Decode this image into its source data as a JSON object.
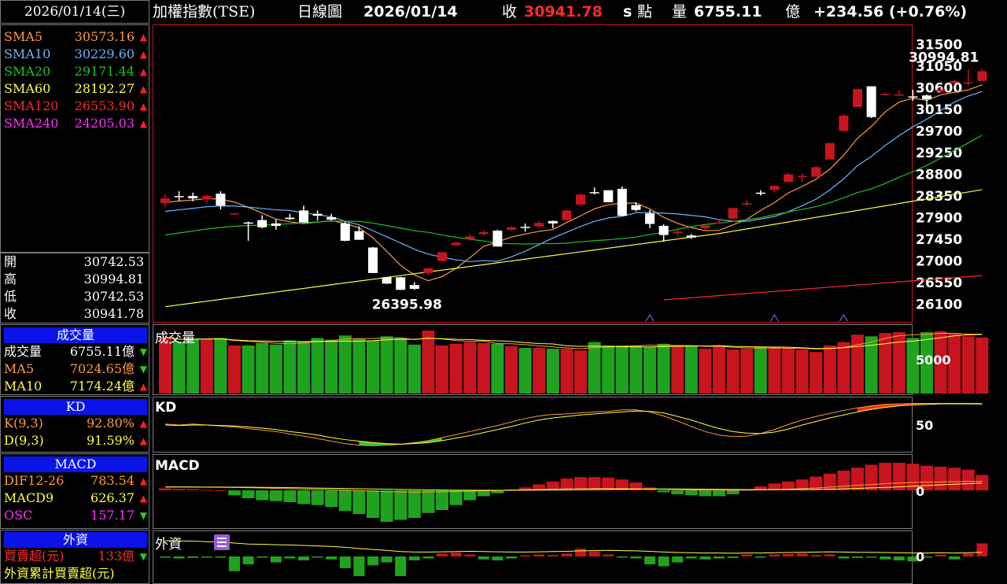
{
  "header": {
    "date": "2026/01/14(三)",
    "index_name": "加權指數(TSE)",
    "chart_kind": "日線圖",
    "quote_date": "2026/01/14",
    "close_label": "收",
    "close_value": "30941.78",
    "s_label": "s",
    "point_label": "點",
    "volume_label": "量",
    "volume_value": "6755.11",
    "volume_unit": "億",
    "change": "+234.56 (+0.76%)"
  },
  "sma": [
    {
      "label": "SMA5",
      "value": "30573.16",
      "color": "#ff9a3c",
      "dir": "up"
    },
    {
      "label": "SMA10",
      "value": "30229.60",
      "color": "#6ab6ff",
      "dir": "up"
    },
    {
      "label": "SMA20",
      "value": "29171.44",
      "color": "#22c022",
      "dir": "up"
    },
    {
      "label": "SMA60",
      "value": "28192.27",
      "color": "#ffff40",
      "dir": "up"
    },
    {
      "label": "SMA120",
      "value": "26553.90",
      "color": "#ff2a2a",
      "dir": "up"
    },
    {
      "label": "SMA240",
      "value": "24205.03",
      "color": "#ff30ff",
      "dir": "up"
    }
  ],
  "ohlc": [
    {
      "label": "開",
      "value": "30742.53"
    },
    {
      "label": "高",
      "value": "30994.81"
    },
    {
      "label": "低",
      "value": "30742.53"
    },
    {
      "label": "收",
      "value": "30941.78"
    }
  ],
  "volume_panel": {
    "header": "成交量",
    "rows": [
      {
        "label": "成交量",
        "value": "6755.11億",
        "color": "#ffffff",
        "dir": "down"
      },
      {
        "label": "MA5",
        "value": "7024.65億",
        "color": "#ff9a3c",
        "dir": "down"
      },
      {
        "label": "MA10",
        "value": "7174.24億",
        "color": "#ffff40",
        "dir": "up"
      }
    ],
    "chart_title": "成交量",
    "axis_label": "5000"
  },
  "kd_panel": {
    "header": "KD",
    "rows": [
      {
        "label": "K(9,3)",
        "value": "92.80%",
        "color": "#ff9a3c",
        "dir": "up"
      },
      {
        "label": "D(9,3)",
        "value": "91.59%",
        "color": "#ffff40",
        "dir": "up"
      }
    ],
    "chart_title": "KD",
    "axis_label": "50"
  },
  "macd_panel": {
    "header": "MACD",
    "rows": [
      {
        "label": "DIF12-26",
        "value": "783.54",
        "color": "#ff9a3c",
        "dir": "up"
      },
      {
        "label": "MACD9",
        "value": "626.37",
        "color": "#ffff40",
        "dir": "up"
      },
      {
        "label": "OSC",
        "value": "157.17",
        "color": "#ff30ff",
        "dir": "down"
      }
    ],
    "chart_title": "MACD",
    "axis_label": "0"
  },
  "foreign_panel": {
    "header": "外資",
    "rows": [
      {
        "label": "買賣超(元)",
        "value": "133億",
        "color": "#ff2a2a",
        "dir": "down"
      },
      {
        "label": "外資累計買賣超(元)",
        "value": "",
        "color": "#ffff40",
        "dir": ""
      }
    ],
    "chart_title": "外資",
    "axis_label": "0"
  },
  "colors": {
    "up": "#c8141e",
    "down": "#ffffff",
    "vol_up": "#c8141e",
    "vol_down": "#1fa31f",
    "arrow_up": "#ff2020",
    "arrow_down": "#22cc22",
    "axis": "#ffffff"
  },
  "chart_data": {
    "type": "candlestick",
    "price_axis": {
      "ticks": [
        31500,
        31050,
        30600,
        30150,
        29700,
        29250,
        28800,
        28350,
        27900,
        27450,
        27000,
        26550,
        26100
      ],
      "ylim": [
        25750,
        31900
      ]
    },
    "annotations": [
      {
        "text": "30994.81",
        "kind": "high"
      },
      {
        "text": "26395.98",
        "kind": "low"
      }
    ],
    "candles": [
      [
        28200,
        28380,
        28120,
        28300
      ],
      [
        28350,
        28450,
        28250,
        28330
      ],
      [
        28350,
        28420,
        28240,
        28300
      ],
      [
        28280,
        28380,
        28200,
        28350
      ],
      [
        28400,
        28450,
        28070,
        28150
      ],
      [
        27990,
        28000,
        27960,
        27990
      ],
      [
        27800,
        27820,
        27420,
        27780
      ],
      [
        27850,
        27950,
        27680,
        27700
      ],
      [
        27780,
        27860,
        27650,
        27730
      ],
      [
        27900,
        27980,
        27850,
        27870
      ],
      [
        28050,
        28150,
        27800,
        27800
      ],
      [
        27980,
        28050,
        27840,
        27940
      ],
      [
        27910,
        27980,
        27840,
        27860
      ],
      [
        27780,
        27820,
        27410,
        27420
      ],
      [
        27620,
        27720,
        27440,
        27440
      ],
      [
        27280,
        27290,
        26750,
        26750
      ],
      [
        26660,
        26670,
        26520,
        26530
      ],
      [
        26660,
        26670,
        26400,
        26400
      ],
      [
        26500,
        26560,
        26400,
        26420
      ],
      [
        26750,
        26850,
        26700,
        26850
      ],
      [
        27000,
        27180,
        27000,
        27180
      ],
      [
        27330,
        27410,
        27290,
        27380
      ],
      [
        27460,
        27560,
        27420,
        27510
      ],
      [
        27560,
        27630,
        27530,
        27600
      ],
      [
        27630,
        27650,
        27300,
        27300
      ],
      [
        27650,
        27720,
        27620,
        27700
      ],
      [
        27710,
        27780,
        27610,
        27690
      ],
      [
        27720,
        27830,
        27680,
        27790
      ],
      [
        27830,
        27840,
        27680,
        27780
      ],
      [
        27850,
        28060,
        27850,
        28050
      ],
      [
        28170,
        28410,
        28170,
        28380
      ],
      [
        28430,
        28530,
        28380,
        28420
      ],
      [
        28470,
        28470,
        28220,
        28220
      ],
      [
        28500,
        28550,
        27930,
        27940
      ],
      [
        28160,
        28220,
        28030,
        28060
      ],
      [
        27990,
        28060,
        27680,
        27770
      ],
      [
        27730,
        27760,
        27400,
        27540
      ],
      [
        27580,
        27650,
        27530,
        27610
      ],
      [
        27530,
        27560,
        27460,
        27490
      ],
      [
        27680,
        27760,
        27640,
        27740
      ],
      [
        27800,
        27850,
        27770,
        27800
      ],
      [
        27880,
        28110,
        27880,
        28100
      ],
      [
        28180,
        28260,
        28140,
        28200
      ],
      [
        28420,
        28470,
        28360,
        28410
      ],
      [
        28480,
        28570,
        28420,
        28560
      ],
      [
        28640,
        28830,
        28640,
        28800
      ],
      [
        28750,
        28830,
        28640,
        28770
      ],
      [
        28750,
        28970,
        28750,
        28950
      ],
      [
        29110,
        29450,
        29110,
        29450
      ],
      [
        29700,
        30050,
        29700,
        30020
      ],
      [
        30200,
        30570,
        30200,
        30570
      ],
      [
        30630,
        30630,
        29970,
        29990
      ],
      [
        30460,
        30500,
        30440,
        30470
      ],
      [
        30460,
        30550,
        30440,
        30460
      ],
      [
        30420,
        30560,
        30330,
        30410
      ],
      [
        30440,
        30460,
        30070,
        30360
      ],
      [
        30520,
        30620,
        30500,
        30560
      ],
      [
        30700,
        30760,
        30650,
        30740
      ],
      [
        30700,
        30980,
        30640,
        30710
      ],
      [
        30742.53,
        30994.81,
        30742.53,
        30941.78
      ]
    ],
    "volume": [
      6800,
      6300,
      6600,
      6600,
      6700,
      5800,
      5800,
      6100,
      5900,
      6400,
      6300,
      6700,
      6500,
      7000,
      6600,
      6400,
      6900,
      6700,
      5900,
      7600,
      5800,
      6000,
      6200,
      6100,
      6000,
      5700,
      5500,
      5500,
      5400,
      5400,
      5200,
      6200,
      5800,
      5800,
      5800,
      5600,
      6000,
      5800,
      5700,
      5400,
      5700,
      5300,
      5400,
      5600,
      5500,
      5500,
      5300,
      5000,
      5800,
      6200,
      7100,
      6900,
      7300,
      7400,
      6700,
      7400,
      7500,
      7300,
      6900,
      6755.11
    ],
    "kd": {
      "k": [
        52,
        50,
        52,
        50,
        48,
        46,
        43,
        40,
        37,
        32,
        28,
        23,
        18,
        13,
        10,
        9,
        10,
        12,
        15,
        19,
        25,
        31,
        37,
        43,
        49,
        56,
        63,
        68,
        71,
        72,
        74,
        76,
        77,
        80,
        80,
        76,
        68,
        58,
        47,
        37,
        30,
        27,
        28,
        33,
        41,
        51,
        60,
        67,
        73,
        79,
        84,
        88,
        91,
        92,
        93,
        93,
        93,
        93,
        93,
        92.8
      ],
      "d": [
        50,
        49,
        50,
        50,
        49,
        48,
        46,
        44,
        41,
        37,
        34,
        30,
        25,
        21,
        18,
        15,
        13,
        12,
        13,
        15,
        19,
        24,
        29,
        35,
        41,
        47,
        54,
        60,
        64,
        67,
        70,
        72,
        74,
        76,
        78,
        77,
        74,
        67,
        60,
        51,
        43,
        37,
        34,
        33,
        36,
        42,
        50,
        57,
        64,
        70,
        76,
        81,
        85,
        88,
        90,
        91,
        92,
        92,
        92,
        91.59
      ]
    },
    "macd": {
      "osc": [
        20,
        15,
        12,
        5,
        0,
        -50,
        -80,
        -100,
        -110,
        -120,
        -140,
        -150,
        -170,
        -210,
        -240,
        -280,
        -320,
        -300,
        -280,
        -230,
        -200,
        -150,
        -100,
        -60,
        -30,
        10,
        30,
        60,
        90,
        120,
        135,
        135,
        130,
        110,
        80,
        30,
        -20,
        -40,
        -50,
        -60,
        -60,
        -40,
        10,
        40,
        70,
        90,
        110,
        140,
        170,
        200,
        230,
        260,
        280,
        280,
        270,
        250,
        240,
        230,
        210,
        157
      ],
      "dif": [
        300,
        290,
        280,
        270,
        260,
        250,
        230,
        200,
        170,
        140,
        110,
        90,
        60,
        20,
        -20,
        -60,
        -120,
        -140,
        -150,
        -150,
        -130,
        -100,
        -70,
        -40,
        -10,
        20,
        50,
        80,
        110,
        140,
        160,
        170,
        160,
        150,
        140,
        120,
        90,
        60,
        40,
        20,
        10,
        10,
        20,
        40,
        70,
        100,
        150,
        200,
        280,
        360,
        430,
        500,
        580,
        640,
        680,
        710,
        730,
        750,
        770,
        783.54
      ],
      "macd": [
        290,
        288,
        286,
        283,
        280,
        275,
        268,
        258,
        245,
        230,
        214,
        197,
        180,
        160,
        140,
        120,
        100,
        80,
        60,
        40,
        28,
        18,
        10,
        5,
        3,
        5,
        10,
        18,
        28,
        40,
        55,
        70,
        85,
        98,
        110,
        118,
        118,
        115,
        110,
        100,
        90,
        80,
        70,
        65,
        62,
        64,
        70,
        80,
        100,
        130,
        170,
        210,
        250,
        300,
        360,
        420,
        480,
        530,
        580,
        626.37
      ]
    },
    "foreign": {
      "net": [
        -10,
        -20,
        -15,
        -10,
        -12,
        -150,
        -80,
        -10,
        -60,
        -20,
        -40,
        -10,
        -30,
        -120,
        -200,
        -90,
        -60,
        -200,
        -40,
        -20,
        30,
        40,
        20,
        -30,
        -40,
        -20,
        10,
        20,
        15,
        30,
        80,
        50,
        20,
        -10,
        -20,
        -80,
        -100,
        -60,
        -20,
        -30,
        -20,
        -15,
        20,
        -10,
        20,
        25,
        30,
        15,
        20,
        -20,
        -15,
        -10,
        -30,
        -40,
        -50,
        -10,
        20,
        -30,
        30,
        133
      ],
      "cum": [
        6.0,
        5.9,
        5.8,
        5.6,
        5.4,
        5.0,
        4.6,
        4.5,
        4.3,
        4.2,
        4.0,
        3.8,
        3.6,
        3.2,
        2.7,
        2.3,
        1.9,
        1.4,
        1.2,
        1.2,
        1.3,
        1.4,
        1.5,
        1.4,
        1.3,
        1.2,
        1.2,
        1.3,
        1.4,
        1.5,
        1.7,
        1.8,
        1.9,
        1.8,
        1.7,
        1.5,
        1.2,
        1.0,
        0.9,
        0.8,
        0.8,
        0.7,
        0.8,
        0.8,
        0.9,
        1.0,
        1.1,
        1.2,
        1.3,
        1.2,
        1.1,
        1.1,
        1.0,
        0.9,
        0.8,
        0.8,
        0.9,
        0.8,
        0.9,
        1.1
      ]
    }
  }
}
